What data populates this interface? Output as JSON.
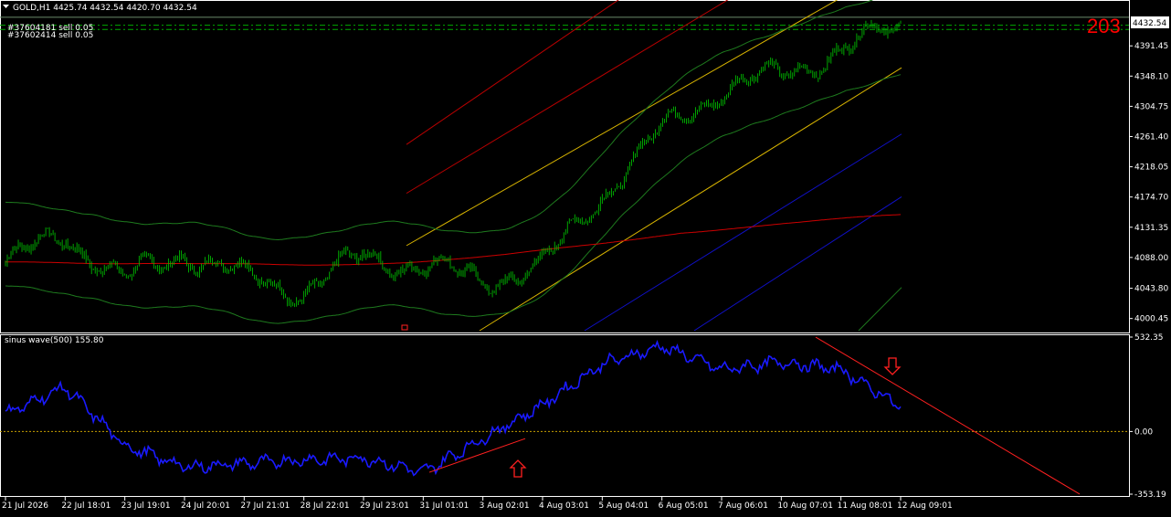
{
  "header": {
    "symbol_line": "GOLD,H1  4425.74 4432.54 4420.70 4432.54",
    "order_1": "#37604181 sell 0.05",
    "order_2": "#37602414 sell 0.05",
    "counter": "203"
  },
  "price_panel": {
    "current_price_label": "4432.54",
    "y_ticks": [
      "4391.45",
      "4348.10",
      "4304.75",
      "4261.40",
      "4218.05",
      "4174.70",
      "4131.35",
      "4088.00",
      "4043.80",
      "4000.45"
    ]
  },
  "indicator_panel": {
    "label": "sinus wave(500) 155.80",
    "y_ticks": [
      "532.35",
      "0.00",
      "-353.19"
    ]
  },
  "time_axis": {
    "labels": [
      "21 Jul 2026",
      "22 Jul 18:01",
      "23 Jul 19:01",
      "24 Jul 20:01",
      "27 Jul 21:01",
      "28 Jul 22:01",
      "29 Jul 23:01",
      "31 Jul 01:01",
      "3 Aug 02:01",
      "4 Aug 03:01",
      "5 Aug 04:01",
      "6 Aug 05:01",
      "7 Aug 06:01",
      "10 Aug 07:01",
      "11 Aug 08:01",
      "12 Aug 09:01"
    ]
  },
  "colors": {
    "background": "#000000",
    "candles": "#00cc00",
    "bollinger": "#1e7a1e",
    "moving_average": "#cc0000",
    "channel_red": "#b80000",
    "channel_yellow": "#d8b400",
    "channel_blue": "#1010c8",
    "sine_wave": "#1a1aff",
    "trendline": "#ff2020",
    "arrows": "#ff2020",
    "order_lines": "#00aa00"
  },
  "chart_data": [
    {
      "type": "candlestick",
      "title": "GOLD,H1",
      "last_ohlc": {
        "open": 4425.74,
        "high": 4432.54,
        "low": 4420.7,
        "close": 4432.54
      },
      "ylim": [
        3983,
        4452
      ],
      "x": [
        "21 Jul 2026",
        "22 Jul 18:01",
        "23 Jul 19:01",
        "24 Jul 20:01",
        "27 Jul 21:01",
        "28 Jul 22:01",
        "29 Jul 23:01",
        "31 Jul 01:01",
        "3 Aug 02:01",
        "4 Aug 03:01",
        "5 Aug 04:01",
        "6 Aug 05:01",
        "7 Aug 06:01",
        "10 Aug 07:01",
        "11 Aug 08:01",
        "12 Aug 09:01"
      ],
      "close_at_labels": [
        4080,
        4120,
        4055,
        4095,
        4060,
        4040,
        4090,
        4075,
        4055,
        4075,
        4180,
        4270,
        4330,
        4350,
        4385,
        4420
      ],
      "series": [
        {
          "name": "GOLD,H1",
          "values": [
            4080,
            4120,
            4055,
            4095,
            4060,
            4040,
            4090,
            4075,
            4055,
            4075,
            4180,
            4270,
            4330,
            4350,
            4385,
            4420
          ]
        }
      ]
    },
    {
      "type": "line",
      "title": "sinus wave(500)",
      "last_value": 155.8,
      "ylim": [
        -353.19,
        532.35
      ],
      "x": [
        "21 Jul 2026",
        "22 Jul 18:01",
        "23 Jul 19:01",
        "24 Jul 20:01",
        "27 Jul 21:01",
        "28 Jul 22:01",
        "29 Jul 23:01",
        "31 Jul 01:01",
        "3 Aug 02:01",
        "4 Aug 03:01",
        "5 Aug 04:01",
        "6 Aug 05:01",
        "7 Aug 06:01",
        "10 Aug 07:01",
        "11 Aug 08:01",
        "12 Aug 09:01"
      ],
      "series": [
        {
          "name": "sinus wave(500)",
          "values": [
            100,
            250,
            -80,
            -200,
            -180,
            -160,
            -150,
            -230,
            -40,
            150,
            380,
            480,
            350,
            390,
            350,
            140
          ]
        }
      ]
    }
  ]
}
